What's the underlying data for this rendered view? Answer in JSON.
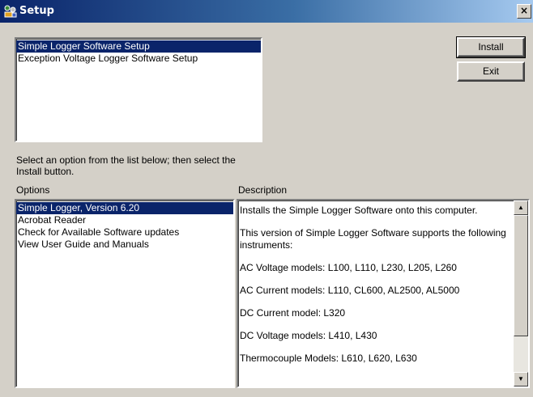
{
  "window": {
    "title": "Setup",
    "close_glyph": "×"
  },
  "setup_list": {
    "items": [
      {
        "label": "Simple Logger Software Setup",
        "selected": true
      },
      {
        "label": "Exception Voltage Logger Software Setup",
        "selected": false
      }
    ]
  },
  "buttons": {
    "install": "Install",
    "exit": "Exit"
  },
  "instruction": {
    "line1": "Select an option from the list below; then select the",
    "line2": "Install button."
  },
  "options": {
    "label": "Options",
    "items": [
      {
        "label": "Simple Logger, Version 6.20",
        "selected": true
      },
      {
        "label": "Acrobat Reader",
        "selected": false
      },
      {
        "label": "Check for Available Software updates",
        "selected": false
      },
      {
        "label": "View User Guide and Manuals",
        "selected": false
      }
    ]
  },
  "description": {
    "label": "Description",
    "paragraphs": [
      "Installs the Simple Logger Software onto this computer.",
      "This version of Simple Logger Software supports the following instruments:",
      "AC Voltage models: L100, L110, L230, L205, L260",
      "AC Current models: L110, CL600, AL2500, AL5000",
      "DC Current model: L320",
      "DC Voltage models: L410, L430",
      "Thermocouple Models: L610, L620, L630"
    ]
  },
  "scrollbar": {
    "up_glyph": "▲",
    "down_glyph": "▼"
  },
  "colors": {
    "titlebar_start": "#0a246a",
    "titlebar_end": "#a6caf0",
    "selection": "#0a246a",
    "face": "#d4d0c8"
  }
}
